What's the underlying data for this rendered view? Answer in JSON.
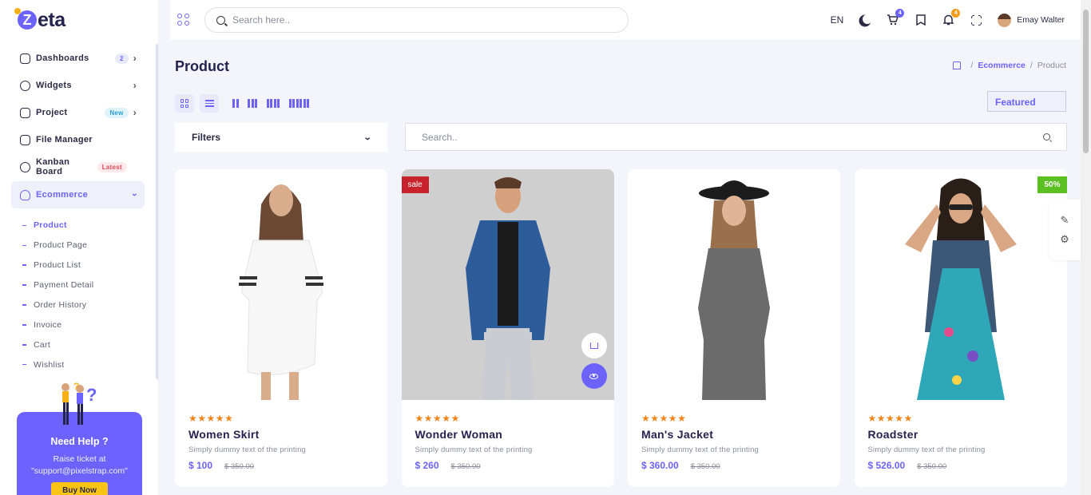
{
  "app": {
    "logo_letter": "Z",
    "logo_text": "eta"
  },
  "header": {
    "search_placeholder": "Search here..",
    "language": "EN",
    "cart_count": "4",
    "notification_count": "4",
    "user_name": "Emay Walter"
  },
  "sidebar": {
    "items": [
      {
        "label": "Dashboards",
        "badge": "2"
      },
      {
        "label": "Widgets"
      },
      {
        "label": "Project",
        "badge": "New"
      },
      {
        "label": "File Manager"
      },
      {
        "label": "Kanban Board",
        "badge": "Latest"
      },
      {
        "label": "Ecommerce"
      }
    ],
    "submenu": [
      "Product",
      "Product Page",
      "Product List",
      "Payment Detail",
      "Order History",
      "Invoice",
      "Cart",
      "Wishlist"
    ],
    "help": {
      "title": "Need Help ?",
      "text": "Raise ticket at \"support@pixelstrap.com\"",
      "button": "Buy Now"
    }
  },
  "page": {
    "title": "Product",
    "breadcrumb": [
      "Ecommerce",
      "Product"
    ],
    "featured_label": "Featured",
    "filters_label": "Filters",
    "search_placeholder": "Search.."
  },
  "products": [
    {
      "name": "Women Skirt",
      "desc": "Simply dummy text of the printing",
      "price": "$ 100",
      "old_price": "$ 350.00",
      "rating": 5,
      "tag": ""
    },
    {
      "name": "Wonder Woman",
      "desc": "Simply dummy text of the printing",
      "price": "$ 260",
      "old_price": "$ 350.00",
      "rating": 5,
      "tag": "sale"
    },
    {
      "name": "Man's Jacket",
      "desc": "Simply dummy text of the printing",
      "price": "$ 360.00",
      "old_price": "$ 350.00",
      "rating": 5,
      "tag": ""
    },
    {
      "name": "Roadster",
      "desc": "Simply dummy text of the printing",
      "price": "$ 526.00",
      "old_price": "$ 350.00",
      "rating": 5,
      "tag": "50%"
    }
  ],
  "colors": {
    "accent": "#6c63ff",
    "sale": "#c8232c",
    "discount": "#5cbf22",
    "star": "#f2841c"
  },
  "icons": [
    "grid-icon",
    "search-icon",
    "moon-icon",
    "cart-icon",
    "bookmark-icon",
    "bell-icon",
    "fullscreen-icon",
    "home-icon",
    "chevron-down-icon",
    "eye-icon",
    "paint-icon",
    "gear-icon"
  ]
}
